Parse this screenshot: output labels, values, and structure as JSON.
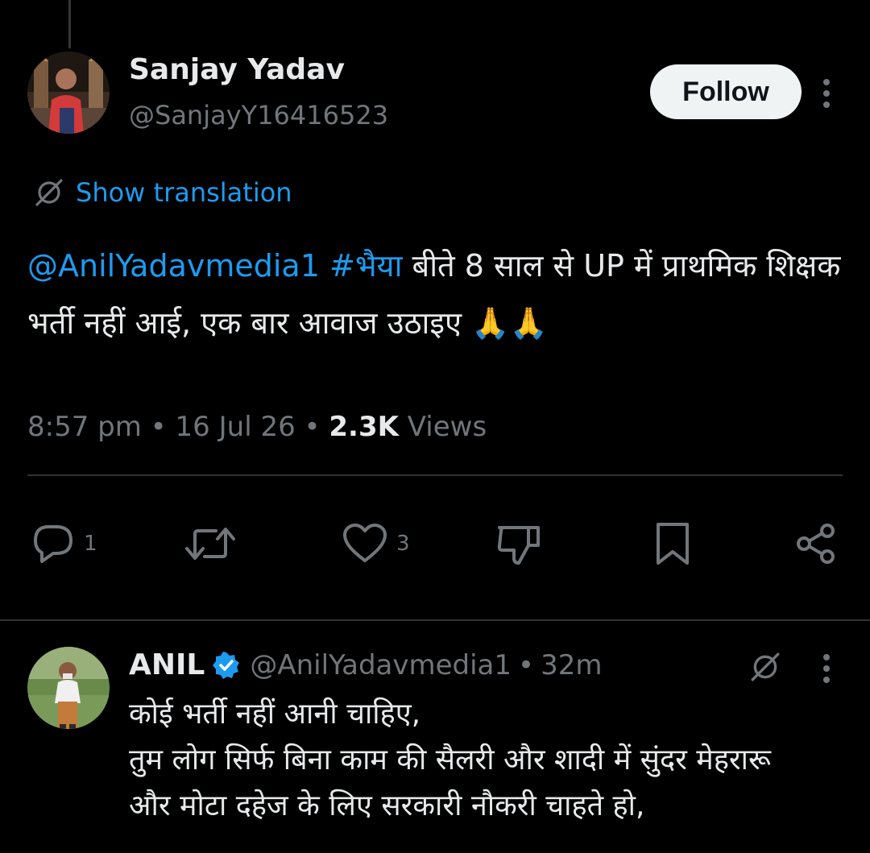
{
  "tweet": {
    "author": {
      "name": "Sanjay Yadav",
      "handle": "@SanjayY16416523"
    },
    "follow_label": "Follow",
    "show_translation_label": "Show translation",
    "text": {
      "mention": "@AnilYadavmedia1",
      "hashtag": "#भैया",
      "body": " बीते 8 साल से UP में प्राथमिक शिक्षक भर्ती नहीं आई, एक बार आवाज उठाइए 🙏🙏"
    },
    "meta": {
      "time": "8:57 pm",
      "separator": " • ",
      "date": "16 Jul 26",
      "views_count": "2.3K",
      "views_label": " Views"
    },
    "actions": {
      "reply_count": "1",
      "like_count": "3"
    }
  },
  "reply": {
    "author": {
      "name": "ANIL",
      "handle": "@AnilYadavmedia1",
      "verified": true
    },
    "separator": "•",
    "time": "32m",
    "lines": [
      "कोई भर्ती नहीं आनी चाहिए,",
      "तुम लोग सिर्फ बिना काम की सैलरी और शादी में सुंदर मेहरारू",
      "और मोटा दहेज के लिए सरकारी नौकरी चाहते हो,"
    ]
  },
  "colors": {
    "background": "#000000",
    "text_primary": "#e7e9ea",
    "text_secondary": "#71767b",
    "accent": "#1d9bf0",
    "divider": "#2f3336"
  },
  "icons": [
    "translate-icon",
    "more-icon",
    "reply-icon",
    "repost-icon",
    "like-icon",
    "dislike-icon",
    "bookmark-icon",
    "share-icon",
    "verified-badge-icon"
  ]
}
